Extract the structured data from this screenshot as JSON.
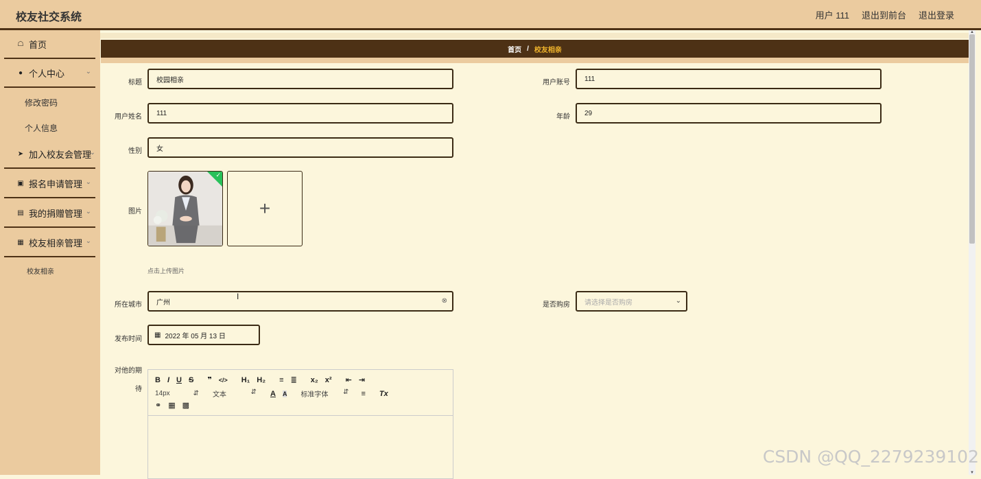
{
  "app": {
    "title": "校友社交系统"
  },
  "header": {
    "user": "用户 111",
    "to_front": "退出到前台",
    "logout": "退出登录"
  },
  "sidebar": {
    "items": [
      {
        "label": "首页",
        "icon": "home-icon"
      },
      {
        "label": "个人中心",
        "icon": "user-icon"
      },
      {
        "label": "加入校友会管理",
        "icon": "send-icon"
      },
      {
        "label": "报名申请管理",
        "icon": "briefcase-icon"
      },
      {
        "label": "我的捐赠管理",
        "icon": "clipboard-icon"
      },
      {
        "label": "校友相亲管理",
        "icon": "grid-icon"
      }
    ],
    "sub_personal": [
      "修改密码",
      "个人信息"
    ],
    "sub_dating": [
      "校友相亲"
    ]
  },
  "breadcrumb": {
    "home": "首页",
    "sep": "/",
    "current": "校友相亲"
  },
  "form": {
    "title_label": "标题",
    "title_value": "校园相亲",
    "account_label": "用户账号",
    "account_value": "111",
    "name_label": "用户姓名",
    "name_value": "111",
    "age_label": "年龄",
    "age_value": "29",
    "gender_label": "性别",
    "gender_value": "女",
    "image_label": "图片",
    "upload_tip": "点击上传图片",
    "plus": "+",
    "city_label": "所在城市",
    "city_value": "广州",
    "house_label": "是否购房",
    "house_placeholder": "请选择是否购房",
    "date_label": "发布时间",
    "date_value": "2022 年 05 月 13 日",
    "expect_label_1": "对他的期",
    "expect_label_2": "待"
  },
  "editor": {
    "row1": [
      "B",
      "I",
      "U",
      "S",
      "❞",
      "</>",
      "H₁",
      "H₂",
      "≡",
      "≣",
      "x₂",
      "x²",
      "⇤",
      "⇥"
    ],
    "font_size": "14px",
    "text_style": "文本",
    "font_family": "标准字体",
    "clear": "Tx"
  },
  "watermark": "CSDN @QQ_2279239102"
}
